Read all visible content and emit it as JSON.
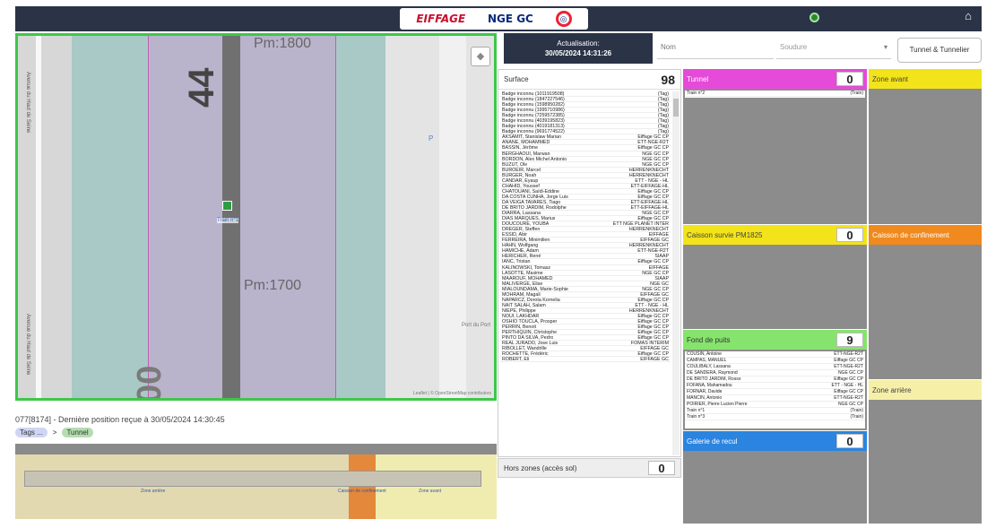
{
  "header": {
    "logo_eiffage": "EIFFAGE",
    "logo_nge": "NGE GC",
    "home_icon": "home-icon",
    "status_icon": "status-dot-icon"
  },
  "map": {
    "pm_top": "Pm:1800",
    "pm_bottom": "Pm:1700",
    "big_top": "44",
    "big_bottom": "00",
    "marker_label": "Train n°1",
    "street_top": "Avenue du Haut de Seine",
    "street_bottom": "Avenue du Haut de Seine",
    "p_label": "P",
    "port_label": "Port du Port",
    "attribution": "Leaflet | © OpenStreetMap contributors",
    "layer_button": "layers-icon"
  },
  "position": {
    "text": "077[8174] - Dernière position reçue à 30/05/2024 14:30:45",
    "tag_a": "Tags ...",
    "separator": ">",
    "tag_b": "Tunnel"
  },
  "minimap": {
    "label_1": "Zone arrière",
    "label_2": "Caisson de confinement",
    "label_3": "Zone avant"
  },
  "controls": {
    "actual_label": "Actualisation:",
    "actual_time": "30/05/2024 14:31:26",
    "nom_placeholder": "Nom",
    "soudure_label": "Soudure",
    "tunnel_button": "Tunnel & Tunnelier"
  },
  "surface": {
    "title": "Surface",
    "count": "98",
    "rows": [
      [
        "Badge inconnu (1011919508)",
        "(Tag)"
      ],
      [
        "Badge inconnu (1847227546)",
        "(Tag)"
      ],
      [
        "Badge inconnu (1598950282)",
        "(Tag)"
      ],
      [
        "Badge inconnu (1995710986)",
        "(Tag)"
      ],
      [
        "Badge inconnu (7259572385)",
        "(Tag)"
      ],
      [
        "Badge inconnu (4039195823)",
        "(Tag)"
      ],
      [
        "Badge inconnu (4019181313)",
        "(Tag)"
      ],
      [
        "Badge inconnu (9691774522)",
        "(Tag)"
      ],
      [
        "AKSAMIT, Stanislaw Marian",
        "Eiffage GC CP"
      ],
      [
        "ANANE, MOHAMMED",
        "ETT-NGE-R2T"
      ],
      [
        "BASSIN, Jérôme",
        "Eiffage GC CP"
      ],
      [
        "BERGHAOUI, Marwan",
        "NGE GC CP"
      ],
      [
        "BORDON, Alex Michel Antonio",
        "NGE GC CP"
      ],
      [
        "BUZUT, Ole",
        "NGE GC CP"
      ],
      [
        "BUROEIR, Marcel",
        "HERRENKNECHT"
      ],
      [
        "BURGER, Noah",
        "HERRENKNECHT"
      ],
      [
        "CANDAR, Eyaup",
        "ETT - NGE - HL"
      ],
      [
        "CHAHID, Youssef",
        "ETT-EIFFAGE-HL"
      ],
      [
        "CHATOUANI, Saïdi-Eddine",
        "Eiffage GC CP"
      ],
      [
        "DA COSTA CUNHA, Jorge Luis",
        "Eiffage GC CP"
      ],
      [
        "DA VEIGA TAVARES, Tiago",
        "ETT-EIFFAGE-HL"
      ],
      [
        "DE BRITO JARDIM, Rodolphe",
        "ETT-EIFFAGE-HL"
      ],
      [
        "DIARRA, Lassana",
        "NGE GC CP"
      ],
      [
        "DIAS MARQUES, Marius",
        "Eiffage GC CP"
      ],
      [
        "DOUCOURE, YOUBA",
        "ETT NGE PLANET INTER"
      ],
      [
        "DREGER, Steffen",
        "HERRENKNECHT"
      ],
      [
        "ESSID, Abir",
        "EIFFAGE"
      ],
      [
        "FERREIRA, Minimilien",
        "EIFFAGE GC"
      ],
      [
        "HAHN, Wolfgang",
        "HERRENKNECHT"
      ],
      [
        "HAMICHE, Adam",
        "ETT-NGE-R2T"
      ],
      [
        "HERICHER, René",
        "SIAAP"
      ],
      [
        "IANC, Tristan",
        "Eiffage GC CP"
      ],
      [
        "KALINOWSKI, Tomasz",
        "EIFFAGE"
      ],
      [
        "LASOTTE, Maxime",
        "NGE GC CP"
      ],
      [
        "MAAROUF, MOHAMED",
        "SIAAP"
      ],
      [
        "MALIVERGE, Elise",
        "NGE GC"
      ],
      [
        "MIALOUNDAMA, Marie-Sophie",
        "NGE GC CP"
      ],
      [
        "MOHRAM, Magali",
        "EIFFAGE GC"
      ],
      [
        "NAPARCZ, Dorota Kornelia",
        "Eiffage GC CP"
      ],
      [
        "NAIT SALAH, Salam",
        "ETT - NGE - HL"
      ],
      [
        "NIEPE, Philippe",
        "HERRENKNECHT"
      ],
      [
        "NOUI, LAKHDAR",
        "Eiffage GC CP"
      ],
      [
        "OSHIO TOUCLA, Prosper",
        "Eiffage GC CP"
      ],
      [
        "PERRIN, Benoit",
        "Eiffage GC CP"
      ],
      [
        "PERTHIQUIN, Christophe",
        "Eiffage GC CP"
      ],
      [
        "PINTO DA SILVA, Pedro",
        "Eiffage GC CP"
      ],
      [
        "REAL JURADO, Jose Luis",
        "FOMAS INTERIM"
      ],
      [
        "RIBOLLET, Wandrille",
        "EIFFAGE GC"
      ],
      [
        "ROCHETTE, Frédéric",
        "Eiffage GC CP"
      ],
      [
        "ROBERT, Eli",
        "EIFFAGE GC"
      ]
    ]
  },
  "hors_zones": {
    "title": "Hors zones (accès sol)",
    "count": "0"
  },
  "zones": {
    "tunnel": {
      "title": "Tunnel",
      "count": "0",
      "rows": [
        [
          "Train n°2",
          "(Train)"
        ]
      ],
      "color": "#e64ad8"
    },
    "zone_avant": {
      "title": "Zone avant",
      "color": "#f2e31a"
    },
    "caisson_survie": {
      "title": "Caisson survie PM1825",
      "count": "0",
      "color": "#f2e31a"
    },
    "caisson_confinement": {
      "title": "Caisson de confinement",
      "color": "#f08a1e"
    },
    "fond_puits": {
      "title": "Fond de puits",
      "count": "9",
      "color": "#86e36d",
      "rows": [
        [
          "COUSIN, Antoine",
          "ETT-NGE-R2T"
        ],
        [
          "CAMPAS, MANUEL",
          "Eiffage GC CP"
        ],
        [
          "COULIBALY, Lassana",
          "ETT-NGE-R2T"
        ],
        [
          "DE SANDERA, Raymond",
          "NGE GC CP"
        ],
        [
          "DE BRITO JARDIM, Rosso",
          "Eiffage GC CP"
        ],
        [
          "FOFANA, Mahamadou",
          "ETT - NGE - HL"
        ],
        [
          "FORNAR, Davide",
          "Eiffage GC CP"
        ],
        [
          "MANCIN, Antonio",
          "ETT-NGE-R2T"
        ],
        [
          "POIRIER, Pierre Lucien Pierre",
          "NGE GC CP"
        ],
        [
          "Train n°1",
          "(Train)"
        ],
        [
          "Train n°3",
          "(Train)"
        ]
      ]
    },
    "zone_arriere": {
      "title": "Zone arrière",
      "color": "#f6efa8"
    },
    "galerie_recul": {
      "title": "Galerie de recul",
      "count": "0",
      "color": "#2a84e0"
    }
  }
}
